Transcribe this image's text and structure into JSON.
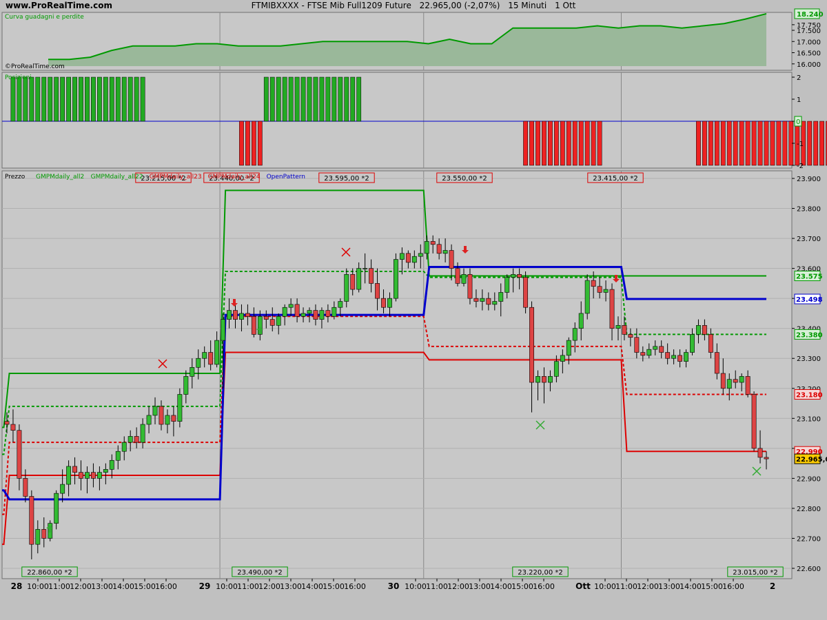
{
  "header": {
    "site": "www.ProRealTime.com",
    "symbol": "FTMIBXXXX - FTSE Mib Full1209 Future",
    "price": "22.965,00 (-2,07%)",
    "timeframe": "15 Minuti",
    "date": "1 Ott"
  },
  "panels": {
    "equity_title": "Curva guadagni e perdite",
    "equity_watermark": "©ProRealTime.com",
    "equity_last": "18.240",
    "equity_ticks": [
      "17.750",
      "17.500",
      "17.000",
      "16.500",
      "16.000"
    ],
    "positions_title": "Posizioni",
    "positions_ticks": [
      "2",
      "1",
      "0",
      "-1",
      "-2"
    ],
    "positions_last": "0",
    "price_title": "Prezzo",
    "legend": [
      {
        "text": "GMPMdaily_all2",
        "color": "#009900"
      },
      {
        "text": "GMPMdaily_all22",
        "color": "#009900"
      },
      {
        "text": "GMPMdaily_all23",
        "color": "#dd0000"
      },
      {
        "text": "GMPMdaily_all24",
        "color": "#dd0000"
      },
      {
        "text": "OpenPattern",
        "color": "#0000cc"
      }
    ]
  },
  "price_ticks": [
    "23.900",
    "23.800",
    "23.700",
    "23.600",
    "23.500",
    "23.400",
    "23.300",
    "23.200",
    "23.100",
    "23.000",
    "22.900",
    "22.800",
    "22.700",
    "22.600"
  ],
  "price_tags": [
    {
      "text": "23.575",
      "color": "#009900",
      "bg": "#d8f0d8"
    },
    {
      "text": "23.498",
      "color": "#0000cc",
      "bg": "#ffffff"
    },
    {
      "text": "23.380",
      "color": "#009900",
      "bg": "#d8f0d8"
    },
    {
      "text": "23.180",
      "color": "#dd0000",
      "bg": "#f5d8d8"
    },
    {
      "text": "22.990",
      "color": "#dd0000",
      "bg": "#f5d8d8"
    },
    {
      "text": "22.965,0",
      "color": "#000000",
      "bg": "#ffcc00"
    }
  ],
  "high_labels": [
    "23.215,00 *2",
    "23.440,00 *2",
    "23.595,00 *2",
    "23.550,00 *2",
    "23.415,00 *2"
  ],
  "low_labels": [
    "22.860,00 *2",
    "23.490,00 *2",
    "23.220,00 *2",
    "23.015,00 *2"
  ],
  "x_axis": {
    "days": [
      "28",
      "29",
      "30",
      "Ott",
      "2"
    ],
    "hours": [
      "10:00",
      "11:00",
      "12:00",
      "13:00",
      "14:00",
      "15:00",
      "16:00"
    ]
  },
  "chart_data": {
    "type": "candlestick",
    "interval": "15 Minuti",
    "equity_curve": [
      16.2,
      16.2,
      16.3,
      16.6,
      16.8,
      16.8,
      16.8,
      16.9,
      16.9,
      16.8,
      16.8,
      16.8,
      16.9,
      17.0,
      17.0,
      17.0,
      17.0,
      17.0,
      16.9,
      17.1,
      16.9,
      16.9,
      17.6,
      17.6,
      17.6,
      17.6,
      17.7,
      17.6,
      17.7,
      17.7,
      17.6,
      17.7,
      17.8,
      18.0,
      18.24
    ],
    "positions": [
      {
        "from": 1,
        "to": 23,
        "value": 2
      },
      {
        "from": 38,
        "to": 42,
        "value": -2
      },
      {
        "from": 42,
        "to": 58,
        "value": 2
      },
      {
        "from": 84,
        "to": 97,
        "value": -2
      },
      {
        "from": 112,
        "to": 137,
        "value": -2
      }
    ],
    "candles": [
      [
        23.09,
        23.12,
        23.05,
        23.08
      ],
      [
        23.08,
        23.13,
        23.02,
        23.06
      ],
      [
        23.06,
        23.08,
        22.86,
        22.9
      ],
      [
        22.9,
        22.93,
        22.82,
        22.84
      ],
      [
        22.84,
        22.86,
        22.63,
        22.68
      ],
      [
        22.68,
        22.76,
        22.65,
        22.73
      ],
      [
        22.73,
        22.77,
        22.67,
        22.7
      ],
      [
        22.7,
        22.76,
        22.69,
        22.75
      ],
      [
        22.75,
        22.86,
        22.73,
        22.85
      ],
      [
        22.85,
        22.93,
        22.82,
        22.88
      ],
      [
        22.88,
        22.96,
        22.84,
        22.94
      ],
      [
        22.94,
        22.97,
        22.88,
        22.92
      ],
      [
        22.92,
        22.96,
        22.86,
        22.9
      ],
      [
        22.9,
        22.94,
        22.85,
        22.92
      ],
      [
        22.92,
        22.95,
        22.87,
        22.9
      ],
      [
        22.9,
        22.94,
        22.86,
        22.92
      ],
      [
        22.92,
        22.95,
        22.88,
        22.93
      ],
      [
        22.93,
        22.98,
        22.9,
        22.96
      ],
      [
        22.96,
        23.01,
        22.93,
        22.99
      ],
      [
        22.99,
        23.04,
        22.96,
        23.02
      ],
      [
        23.02,
        23.06,
        22.99,
        23.04
      ],
      [
        23.04,
        23.07,
        23.0,
        23.02
      ],
      [
        23.02,
        23.1,
        23.0,
        23.08
      ],
      [
        23.08,
        23.14,
        23.05,
        23.11
      ],
      [
        23.11,
        23.17,
        23.08,
        23.14
      ],
      [
        23.14,
        23.16,
        23.06,
        23.08
      ],
      [
        23.08,
        23.13,
        23.05,
        23.11
      ],
      [
        23.11,
        23.14,
        23.04,
        23.09
      ],
      [
        23.09,
        23.2,
        23.07,
        23.18
      ],
      [
        23.18,
        23.26,
        23.15,
        23.24
      ],
      [
        23.24,
        23.3,
        23.2,
        23.27
      ],
      [
        23.27,
        23.33,
        23.23,
        23.3
      ],
      [
        23.3,
        23.34,
        23.27,
        23.32
      ],
      [
        23.32,
        23.36,
        23.26,
        23.28
      ],
      [
        23.28,
        23.39,
        23.27,
        23.36
      ],
      [
        23.36,
        23.45,
        23.2,
        23.43
      ],
      [
        23.43,
        23.5,
        23.4,
        23.46
      ],
      [
        23.46,
        23.49,
        23.4,
        23.43
      ],
      [
        23.43,
        23.48,
        23.39,
        23.45
      ],
      [
        23.45,
        23.48,
        23.41,
        23.44
      ],
      [
        23.44,
        23.47,
        23.37,
        23.38
      ],
      [
        23.38,
        23.46,
        23.36,
        23.44
      ],
      [
        23.44,
        23.46,
        23.4,
        23.43
      ],
      [
        23.43,
        23.47,
        23.39,
        23.41
      ],
      [
        23.41,
        23.45,
        23.38,
        23.44
      ],
      [
        23.44,
        23.48,
        23.41,
        23.47
      ],
      [
        23.47,
        23.5,
        23.44,
        23.48
      ],
      [
        23.48,
        23.5,
        23.42,
        23.44
      ],
      [
        23.44,
        23.47,
        23.42,
        23.45
      ],
      [
        23.45,
        23.47,
        23.42,
        23.46
      ],
      [
        23.46,
        23.48,
        23.41,
        23.43
      ],
      [
        23.43,
        23.47,
        23.4,
        23.46
      ],
      [
        23.46,
        23.48,
        23.42,
        23.44
      ],
      [
        23.44,
        23.49,
        23.43,
        23.47
      ],
      [
        23.47,
        23.5,
        23.44,
        23.49
      ],
      [
        23.49,
        23.6,
        23.47,
        23.58
      ],
      [
        23.58,
        23.6,
        23.51,
        23.53
      ],
      [
        23.53,
        23.62,
        23.52,
        23.6
      ],
      [
        23.6,
        23.65,
        23.55,
        23.6
      ],
      [
        23.6,
        23.63,
        23.52,
        23.55
      ],
      [
        23.55,
        23.6,
        23.46,
        23.5
      ],
      [
        23.5,
        23.53,
        23.45,
        23.47
      ],
      [
        23.47,
        23.52,
        23.44,
        23.5
      ],
      [
        23.5,
        23.65,
        23.49,
        23.63
      ],
      [
        23.63,
        23.67,
        23.58,
        23.65
      ],
      [
        23.65,
        23.66,
        23.6,
        23.62
      ],
      [
        23.62,
        23.66,
        23.6,
        23.64
      ],
      [
        23.64,
        23.68,
        23.6,
        23.65
      ],
      [
        23.65,
        23.71,
        23.63,
        23.69
      ],
      [
        23.69,
        23.71,
        23.65,
        23.68
      ],
      [
        23.68,
        23.7,
        23.63,
        23.65
      ],
      [
        23.65,
        23.7,
        23.62,
        23.66
      ],
      [
        23.66,
        23.68,
        23.56,
        23.6
      ],
      [
        23.6,
        23.62,
        23.54,
        23.55
      ],
      [
        23.55,
        23.6,
        23.54,
        23.58
      ],
      [
        23.58,
        23.6,
        23.48,
        23.5
      ],
      [
        23.5,
        23.53,
        23.47,
        23.49
      ],
      [
        23.49,
        23.53,
        23.46,
        23.5
      ],
      [
        23.5,
        23.52,
        23.46,
        23.48
      ],
      [
        23.48,
        23.52,
        23.46,
        23.49
      ],
      [
        23.49,
        23.55,
        23.44,
        23.52
      ],
      [
        23.52,
        23.58,
        23.5,
        23.57
      ],
      [
        23.57,
        23.6,
        23.52,
        23.58
      ],
      [
        23.58,
        23.6,
        23.53,
        23.57
      ],
      [
        23.57,
        23.59,
        23.45,
        23.47
      ],
      [
        23.47,
        23.49,
        23.12,
        23.22
      ],
      [
        23.22,
        23.26,
        23.16,
        23.24
      ],
      [
        23.24,
        23.27,
        23.15,
        23.22
      ],
      [
        23.22,
        23.26,
        23.19,
        23.24
      ],
      [
        23.24,
        23.31,
        23.22,
        23.29
      ],
      [
        23.29,
        23.33,
        23.25,
        23.31
      ],
      [
        23.31,
        23.37,
        23.28,
        23.36
      ],
      [
        23.36,
        23.42,
        23.32,
        23.4
      ],
      [
        23.4,
        23.49,
        23.36,
        23.45
      ],
      [
        23.45,
        23.58,
        23.43,
        23.56
      ],
      [
        23.56,
        23.59,
        23.5,
        23.54
      ],
      [
        23.54,
        23.57,
        23.5,
        23.52
      ],
      [
        23.52,
        23.56,
        23.49,
        23.53
      ],
      [
        23.53,
        23.55,
        23.36,
        23.4
      ],
      [
        23.4,
        23.44,
        23.36,
        23.41
      ],
      [
        23.41,
        23.44,
        23.36,
        23.38
      ],
      [
        23.38,
        23.4,
        23.34,
        23.37
      ],
      [
        23.37,
        23.4,
        23.3,
        23.32
      ],
      [
        23.32,
        23.34,
        23.29,
        23.31
      ],
      [
        23.31,
        23.35,
        23.3,
        23.33
      ],
      [
        23.33,
        23.36,
        23.31,
        23.34
      ],
      [
        23.34,
        23.36,
        23.3,
        23.32
      ],
      [
        23.32,
        23.35,
        23.28,
        23.3
      ],
      [
        23.3,
        23.33,
        23.28,
        23.31
      ],
      [
        23.31,
        23.33,
        23.27,
        23.29
      ],
      [
        23.29,
        23.33,
        23.27,
        23.32
      ],
      [
        23.32,
        23.4,
        23.31,
        23.38
      ],
      [
        23.38,
        23.43,
        23.35,
        23.41
      ],
      [
        23.41,
        23.43,
        23.36,
        23.38
      ],
      [
        23.38,
        23.4,
        23.3,
        23.32
      ],
      [
        23.32,
        23.35,
        23.23,
        23.25
      ],
      [
        23.25,
        23.3,
        23.18,
        23.2
      ],
      [
        23.2,
        23.25,
        23.16,
        23.23
      ],
      [
        23.23,
        23.26,
        23.2,
        23.22
      ],
      [
        23.22,
        23.25,
        23.19,
        23.24
      ],
      [
        23.24,
        23.26,
        23.17,
        23.18
      ],
      [
        23.18,
        23.19,
        22.99,
        23.0
      ],
      [
        23.0,
        23.06,
        22.95,
        22.97
      ],
      [
        22.97,
        22.99,
        22.93,
        22.965
      ]
    ],
    "series": [
      {
        "name": "GMPMdaily_all2",
        "color": "#009900",
        "style": "solid",
        "segments": [
          23.07,
          23.25,
          23.86,
          23.575,
          23.575
        ]
      },
      {
        "name": "GMPMdaily_all22",
        "color": "#009900",
        "style": "dashed",
        "segments": [
          22.98,
          23.14,
          23.59,
          23.57,
          23.38
        ]
      },
      {
        "name": "GMPMdaily_all23",
        "color": "#dd0000",
        "style": "dashed",
        "segments": [
          22.78,
          23.02,
          23.44,
          23.34,
          23.18
        ]
      },
      {
        "name": "GMPMdaily_all24",
        "color": "#dd0000",
        "style": "solid",
        "segments": [
          22.68,
          22.91,
          23.32,
          23.295,
          22.99
        ]
      },
      {
        "name": "OpenPattern",
        "color": "#0000cc",
        "style": "solid",
        "segments": [
          22.86,
          22.83,
          23.445,
          23.605,
          23.498
        ]
      }
    ],
    "ylim": [
      22.56,
      23.92
    ],
    "last": 22.965
  }
}
